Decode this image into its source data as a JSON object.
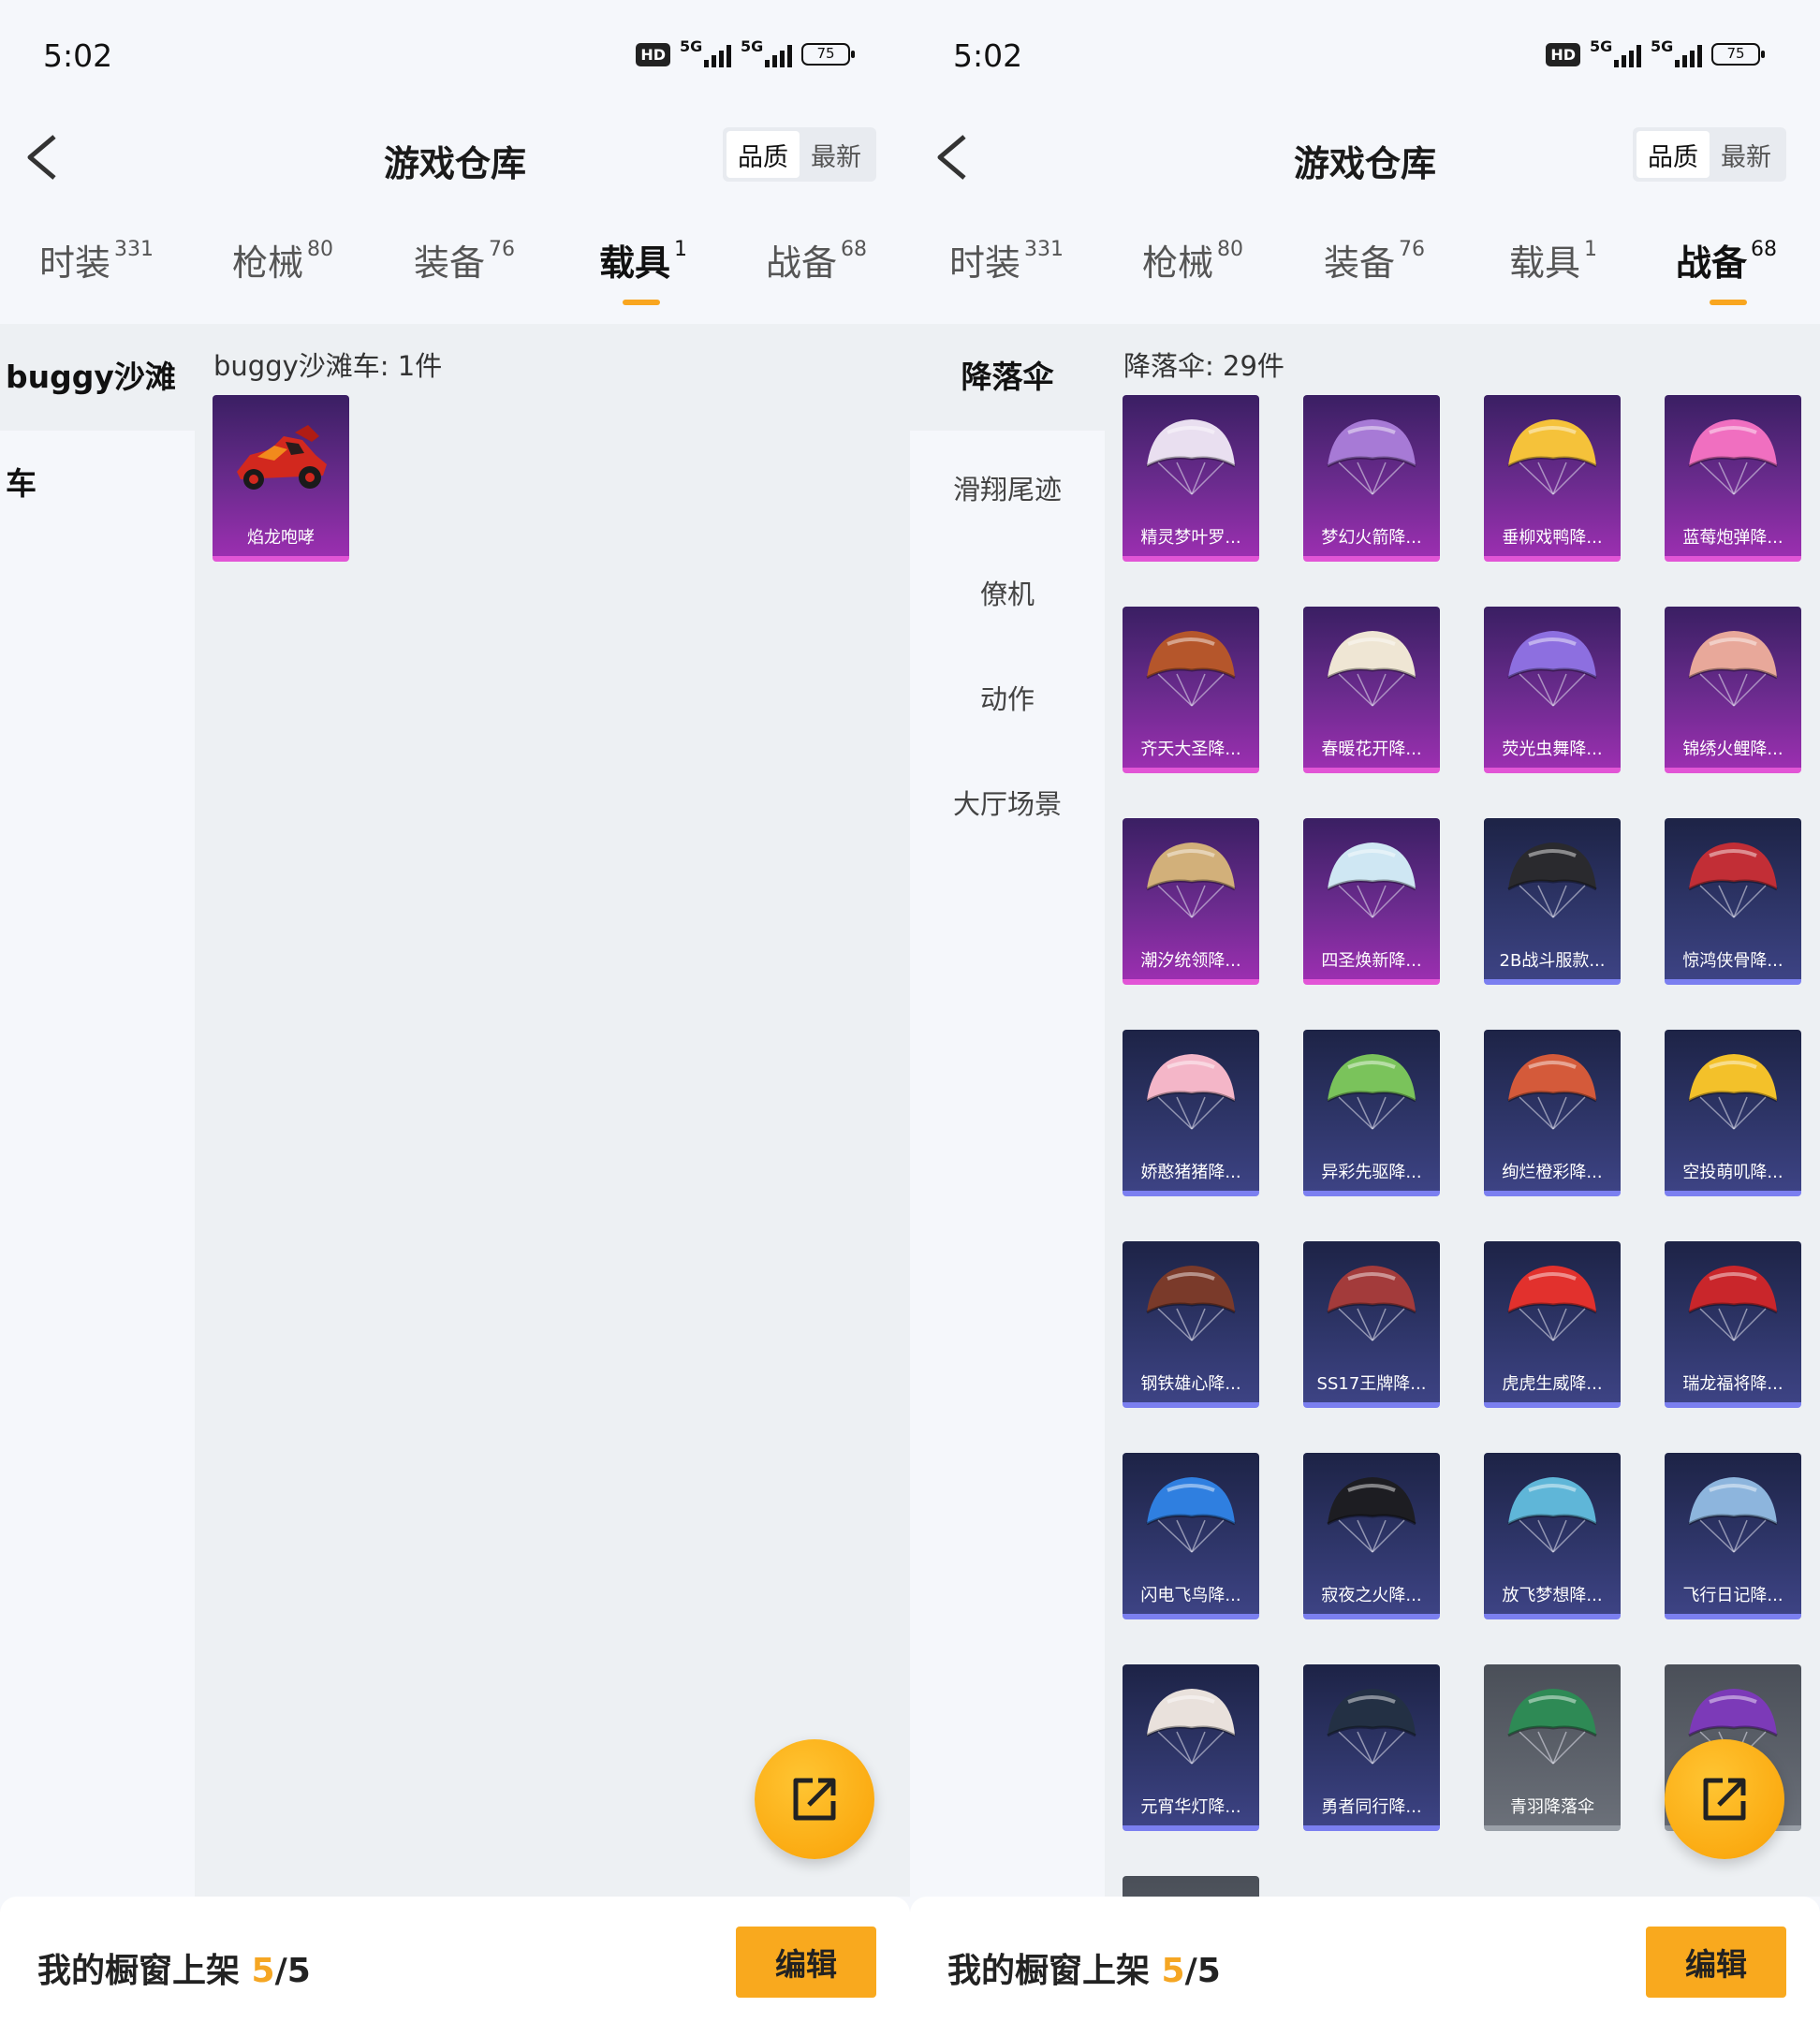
{
  "screens": [
    {
      "status_bar": {
        "time": "5:02",
        "hd_label": "HD",
        "net1": "5G",
        "net2": "5G",
        "battery": "75"
      },
      "nav": {
        "title": "游戏仓库",
        "sort_quality": "品质",
        "sort_latest": "最新"
      },
      "tabs": [
        {
          "label": "时装",
          "count": "331",
          "active": false
        },
        {
          "label": "枪械",
          "count": "80",
          "active": false
        },
        {
          "label": "装备",
          "count": "76",
          "active": false
        },
        {
          "label": "载具",
          "count": "1",
          "active": true
        },
        {
          "label": "战备",
          "count": "68",
          "active": false
        }
      ],
      "sidebar": [
        {
          "label": "buggy沙滩车",
          "active": true
        }
      ],
      "section_header": "buggy沙滩车: 1件",
      "items": [
        {
          "name": "焰龙咆哮",
          "rarity": "purple",
          "icon": "vehicle-icon",
          "color": "#d2281e"
        }
      ],
      "bottom": {
        "prefix": "我的橱窗上架 ",
        "current": "5",
        "slash": "/",
        "total": "5",
        "edit": "编辑"
      }
    },
    {
      "status_bar": {
        "time": "5:02",
        "hd_label": "HD",
        "net1": "5G",
        "net2": "5G",
        "battery": "75"
      },
      "nav": {
        "title": "游戏仓库",
        "sort_quality": "品质",
        "sort_latest": "最新"
      },
      "tabs": [
        {
          "label": "时装",
          "count": "331",
          "active": false
        },
        {
          "label": "枪械",
          "count": "80",
          "active": false
        },
        {
          "label": "装备",
          "count": "76",
          "active": false
        },
        {
          "label": "载具",
          "count": "1",
          "active": false
        },
        {
          "label": "战备",
          "count": "68",
          "active": true
        }
      ],
      "sidebar": [
        {
          "label": "降落伞",
          "active": true
        },
        {
          "label": "滑翔尾迹",
          "active": false
        },
        {
          "label": "僚机",
          "active": false
        },
        {
          "label": "动作",
          "active": false
        },
        {
          "label": "大厅场景",
          "active": false
        }
      ],
      "section_header": "降落伞: 29件",
      "items": [
        {
          "name": "精灵梦叶罗...",
          "rarity": "purple",
          "icon": "parachute-icon",
          "color": "#e9dff0"
        },
        {
          "name": "梦幻火箭降...",
          "rarity": "purple",
          "icon": "parachute-icon",
          "color": "#a77ad6"
        },
        {
          "name": "垂柳戏鸭降...",
          "rarity": "purple",
          "icon": "parachute-icon",
          "color": "#f5c23a"
        },
        {
          "name": "蓝莓炮弹降...",
          "rarity": "purple",
          "icon": "parachute-icon",
          "color": "#f06fc0"
        },
        {
          "name": "齐天大圣降...",
          "rarity": "purple",
          "icon": "parachute-icon",
          "color": "#b5562b"
        },
        {
          "name": "春暖花开降...",
          "rarity": "purple",
          "icon": "parachute-icon",
          "color": "#efe6d4"
        },
        {
          "name": "荧光虫舞降...",
          "rarity": "purple",
          "icon": "parachute-icon",
          "color": "#8d6fe0"
        },
        {
          "name": "锦绣火鲤降...",
          "rarity": "purple",
          "icon": "parachute-icon",
          "color": "#e8a89a"
        },
        {
          "name": "潮汐统领降...",
          "rarity": "purple",
          "icon": "parachute-icon",
          "color": "#d2b07a"
        },
        {
          "name": "四圣焕新降...",
          "rarity": "purple",
          "icon": "parachute-icon",
          "color": "#cfe7f3"
        },
        {
          "name": "2B战斗服款...",
          "rarity": "blue",
          "icon": "parachute-icon",
          "color": "#2a2a2e"
        },
        {
          "name": "惊鸿侠骨降...",
          "rarity": "blue",
          "icon": "parachute-icon",
          "color": "#c22e36"
        },
        {
          "name": "娇憨猪猪降...",
          "rarity": "blue",
          "icon": "parachute-icon",
          "color": "#f4b6c8"
        },
        {
          "name": "异彩先驱降...",
          "rarity": "blue",
          "icon": "parachute-icon",
          "color": "#7ac35b"
        },
        {
          "name": "绚烂橙彩降...",
          "rarity": "blue",
          "icon": "parachute-icon",
          "color": "#d45a3a"
        },
        {
          "name": "空投萌叽降...",
          "rarity": "blue",
          "icon": "parachute-icon",
          "color": "#f3c12a"
        },
        {
          "name": "钢铁雄心降...",
          "rarity": "blue",
          "icon": "parachute-icon",
          "color": "#7a3a2a"
        },
        {
          "name": "SS17王牌降...",
          "rarity": "blue",
          "icon": "parachute-icon",
          "color": "#a33b3b"
        },
        {
          "name": "虎虎生威降...",
          "rarity": "blue",
          "icon": "parachute-icon",
          "color": "#e2312d"
        },
        {
          "name": "瑞龙福将降...",
          "rarity": "blue",
          "icon": "parachute-icon",
          "color": "#c9262b"
        },
        {
          "name": "闪电飞鸟降...",
          "rarity": "blue",
          "icon": "parachute-icon",
          "color": "#2f7fe0"
        },
        {
          "name": "寂夜之火降...",
          "rarity": "blue",
          "icon": "parachute-icon",
          "color": "#1d1d22"
        },
        {
          "name": "放飞梦想降...",
          "rarity": "blue",
          "icon": "parachute-icon",
          "color": "#5fb6d8"
        },
        {
          "name": "飞行日记降...",
          "rarity": "blue",
          "icon": "parachute-icon",
          "color": "#8db5dd"
        },
        {
          "name": "元宵华灯降...",
          "rarity": "blue",
          "icon": "parachute-icon",
          "color": "#e9e1dc"
        },
        {
          "name": "勇者同行降...",
          "rarity": "blue",
          "icon": "parachute-icon",
          "color": "#233044"
        },
        {
          "name": "青羽降落伞",
          "rarity": "gray",
          "icon": "parachute-icon",
          "color": "#2e8a55"
        },
        {
          "name": "",
          "rarity": "gray",
          "icon": "parachute-icon",
          "color": "#7c3ab8"
        },
        {
          "name": "",
          "rarity": "gray",
          "icon": "",
          "color": ""
        }
      ],
      "bottom": {
        "prefix": "我的橱窗上架 ",
        "current": "5",
        "slash": "/",
        "total": "5",
        "edit": "编辑"
      }
    }
  ]
}
